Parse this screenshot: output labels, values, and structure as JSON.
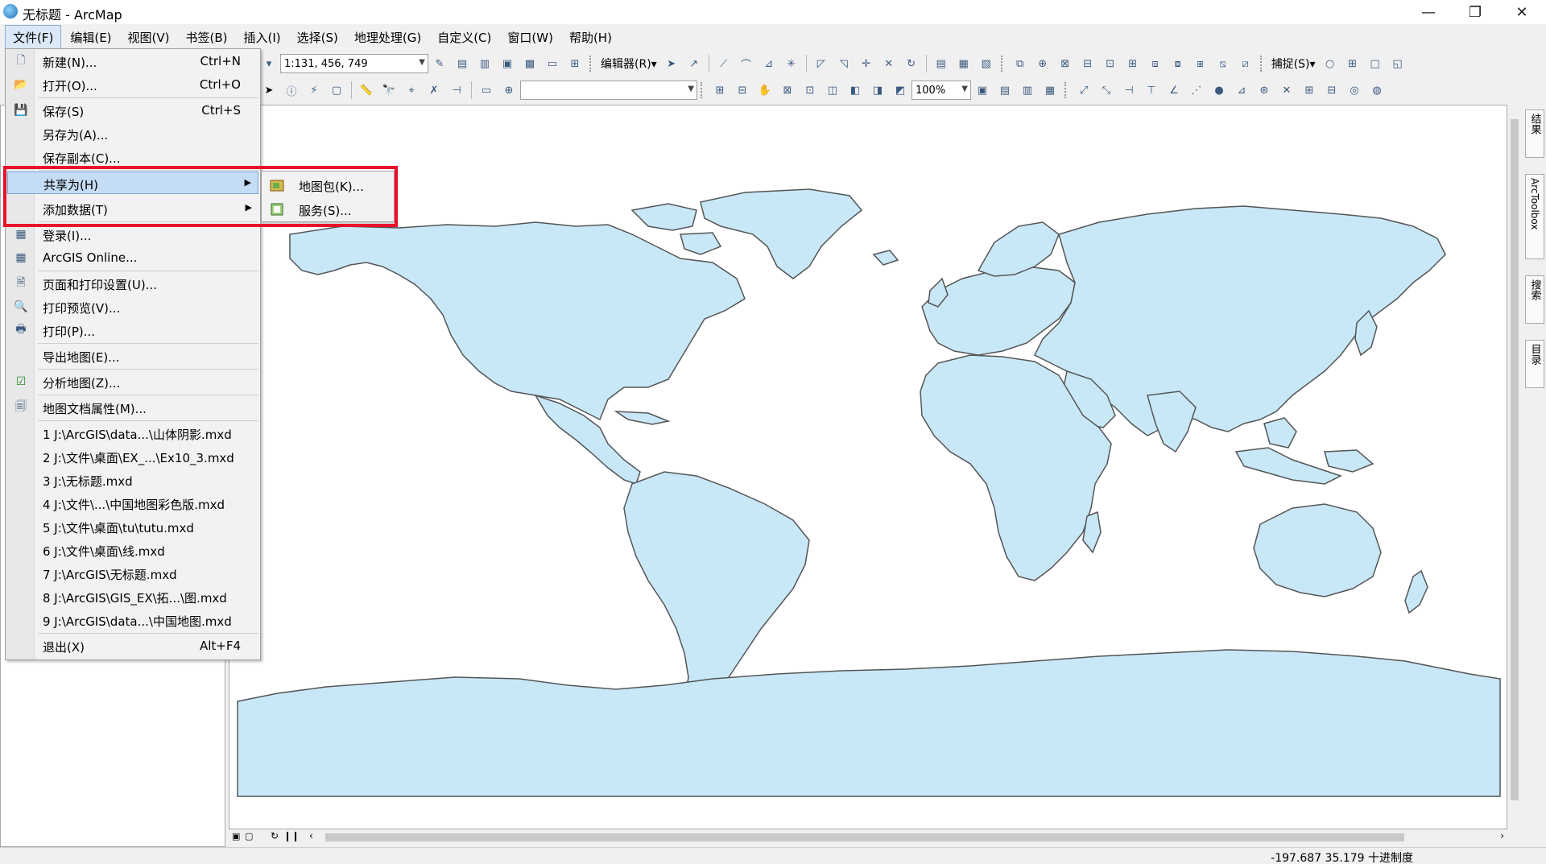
{
  "window": {
    "title": "无标题 - ArcMap",
    "minimize": "—",
    "restore": "❐",
    "close": "✕"
  },
  "menubar": [
    {
      "label": "文件(F)",
      "active": true
    },
    {
      "label": "编辑(E)"
    },
    {
      "label": "视图(V)"
    },
    {
      "label": "书签(B)"
    },
    {
      "label": "插入(I)"
    },
    {
      "label": "选择(S)"
    },
    {
      "label": "地理处理(G)"
    },
    {
      "label": "自定义(C)"
    },
    {
      "label": "窗口(W)"
    },
    {
      "label": "帮助(H)"
    }
  ],
  "toolbar": {
    "scale_value": "1:131, 456, 749",
    "editor_label": "编辑器(R)▾",
    "snapping_label": "捕捉(S)▾",
    "zoom_value": "100%"
  },
  "file_menu": {
    "items": [
      {
        "label": "新建(N)...",
        "shortcut": "Ctrl+N",
        "icon": "new-document-icon",
        "glyph": "🗋"
      },
      {
        "label": "打开(O)...",
        "shortcut": "Ctrl+O",
        "icon": "open-folder-icon",
        "glyph": "📂"
      },
      {
        "label": "保存(S)",
        "shortcut": "Ctrl+S",
        "icon": "save-icon",
        "glyph": "💾"
      },
      {
        "label": "另存为(A)...",
        "shortcut": "",
        "icon": "",
        "glyph": ""
      },
      {
        "label": "保存副本(C)...",
        "shortcut": "",
        "icon": "",
        "glyph": ""
      },
      {
        "label": "共享为(H)",
        "shortcut": "",
        "icon": "",
        "glyph": "",
        "submenu": true,
        "highlighted": true
      },
      {
        "label": "添加数据(T)",
        "shortcut": "",
        "icon": "",
        "glyph": "",
        "submenu": true
      },
      {
        "label": "登录(I)...",
        "shortcut": "",
        "icon": "sign-in-icon",
        "glyph": "▦"
      },
      {
        "label": "ArcGIS Online...",
        "shortcut": "",
        "icon": "arcgis-online-icon",
        "glyph": "▦"
      },
      {
        "label": "页面和打印设置(U)...",
        "shortcut": "",
        "icon": "page-setup-icon",
        "glyph": "🗎"
      },
      {
        "label": "打印预览(V)...",
        "shortcut": "",
        "icon": "print-preview-icon",
        "glyph": "🔍"
      },
      {
        "label": "打印(P)...",
        "shortcut": "",
        "icon": "print-icon",
        "glyph": "🖶"
      },
      {
        "label": "导出地图(E)...",
        "shortcut": "",
        "icon": "",
        "glyph": ""
      },
      {
        "label": "分析地图(Z)...",
        "shortcut": "",
        "icon": "analyze-map-icon",
        "glyph": "☑"
      },
      {
        "label": "地图文档属性(M)...",
        "shortcut": "",
        "icon": "map-properties-icon",
        "glyph": "🗐"
      },
      {
        "label": "1 J:\\ArcGIS\\data...\\山体阴影.mxd",
        "shortcut": ""
      },
      {
        "label": "2 J:\\文件\\桌面\\EX_...\\Ex10_3.mxd",
        "shortcut": ""
      },
      {
        "label": "3 J:\\无标题.mxd",
        "shortcut": ""
      },
      {
        "label": "4 J:\\文件\\...\\中国地图彩色版.mxd",
        "shortcut": ""
      },
      {
        "label": "5 J:\\文件\\桌面\\tu\\tutu.mxd",
        "shortcut": ""
      },
      {
        "label": "6 J:\\文件\\桌面\\线.mxd",
        "shortcut": ""
      },
      {
        "label": "7 J:\\ArcGIS\\无标题.mxd",
        "shortcut": ""
      },
      {
        "label": "8 J:\\ArcGIS\\GIS_EX\\拓...\\图.mxd",
        "shortcut": ""
      },
      {
        "label": "9 J:\\ArcGIS\\data...\\中国地图.mxd",
        "shortcut": ""
      },
      {
        "label": "退出(X)",
        "shortcut": "Alt+F4",
        "icon": "",
        "glyph": ""
      }
    ]
  },
  "submenu": {
    "items": [
      {
        "label": "地图包(K)...",
        "icon": "map-package-icon"
      },
      {
        "label": "服务(S)...",
        "icon": "service-icon"
      }
    ]
  },
  "right_dock": {
    "tabs": [
      "结果",
      "ArcToolbox",
      "搜索",
      "目录"
    ]
  },
  "status": {
    "coords": "-197.687  35.179 十进制度"
  },
  "colors": {
    "land": "#c8e8f8",
    "coast": "#555555",
    "highlight_border": "#e8102a"
  }
}
